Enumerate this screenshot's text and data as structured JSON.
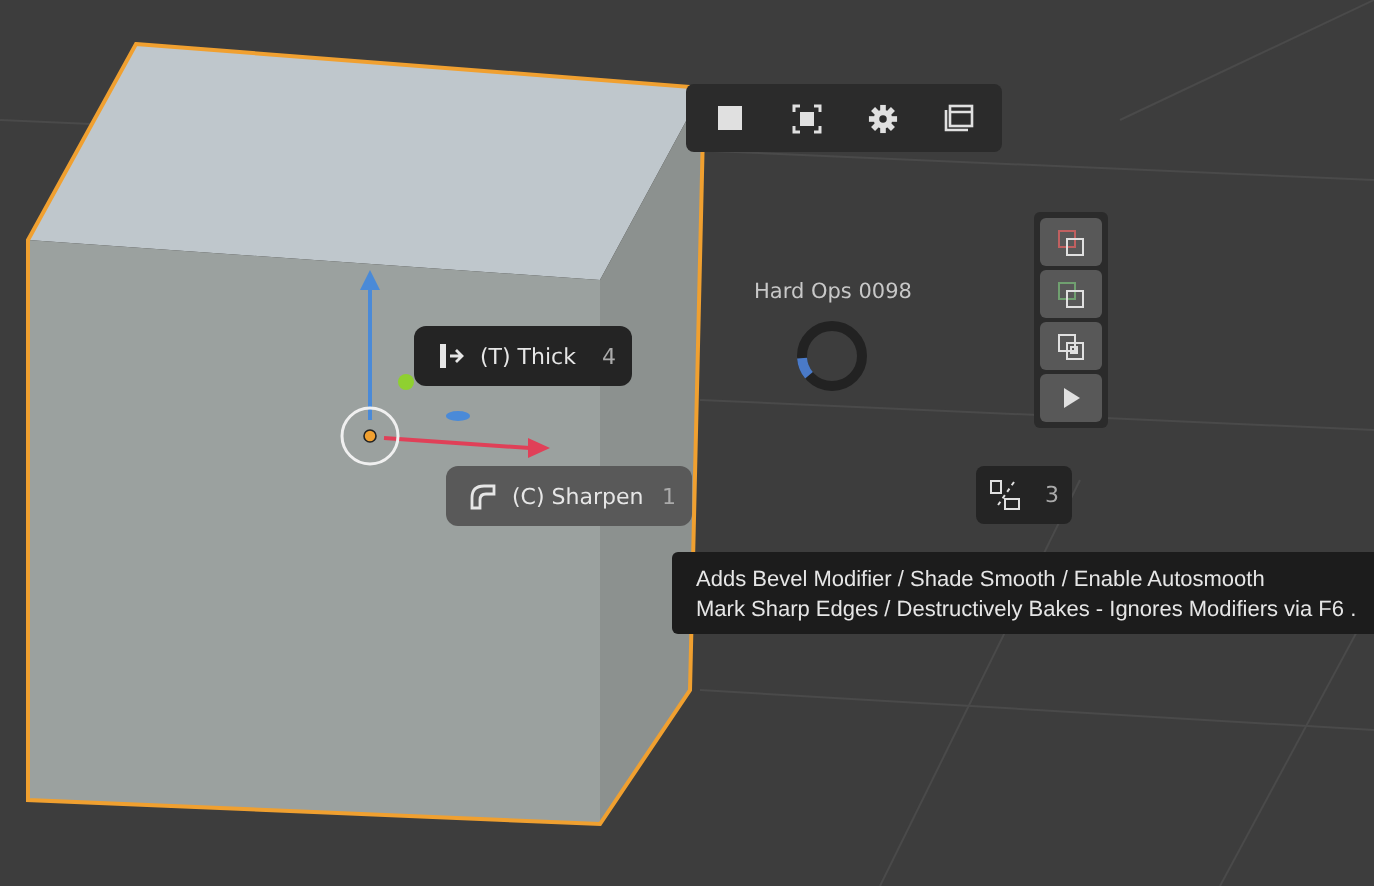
{
  "header_toolbar": {
    "buttons": [
      {
        "kind": "square"
      },
      {
        "kind": "frame"
      },
      {
        "kind": "gear"
      },
      {
        "kind": "window"
      }
    ]
  },
  "pie_menu": [
    {
      "label": "(T) Thick",
      "key": "4",
      "kind": "thick",
      "selected": false
    },
    {
      "label": "(C) Sharpen",
      "key": "1",
      "kind": "sharpen",
      "selected": true
    }
  ],
  "loader": {
    "title": "Hard Ops 0098",
    "level": 0.1
  },
  "side_stack": [
    {
      "kind": "red"
    },
    {
      "kind": "green"
    },
    {
      "kind": "inset"
    },
    {
      "kind": "play"
    }
  ],
  "mode_badge": {
    "count": "3"
  },
  "tooltip": {
    "lines": [
      "Adds Bevel Modifier / Shade Smooth / Enable Autosmooth",
      "Mark Sharp Edges / Destructively Bakes - Ignores Modifiers via F6 ."
    ]
  }
}
